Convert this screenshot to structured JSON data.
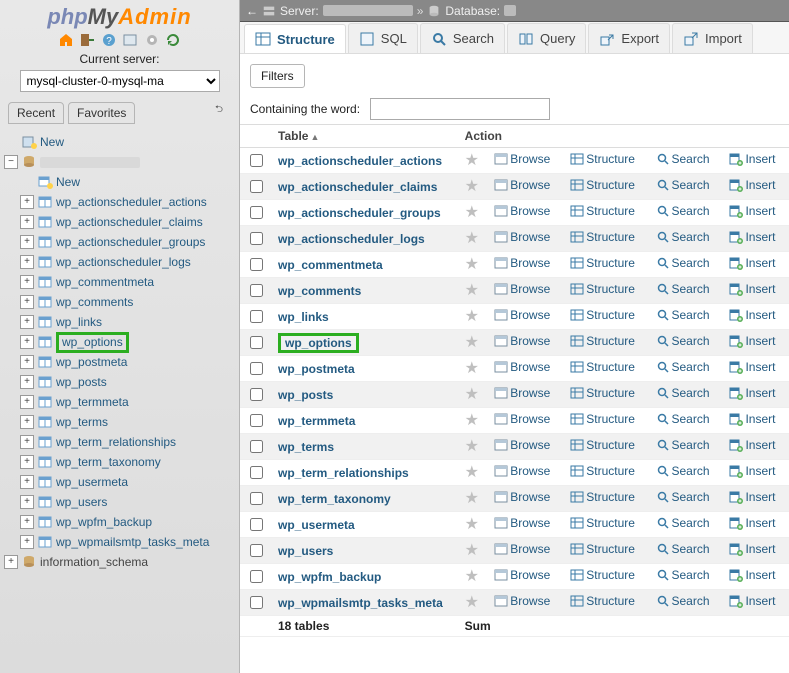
{
  "sidebar": {
    "logo": {
      "php": "php",
      "my": "My",
      "admin": "Admin"
    },
    "current_server_label": "Current server:",
    "server_select_value": "mysql-cluster-0-mysql-ma",
    "tabs": {
      "recent": "Recent",
      "favorites": "Favorites"
    },
    "root_new": "New",
    "db_new": "New",
    "tables": [
      "wp_actionscheduler_actions",
      "wp_actionscheduler_claims",
      "wp_actionscheduler_groups",
      "wp_actionscheduler_logs",
      "wp_commentmeta",
      "wp_comments",
      "wp_links",
      "wp_options",
      "wp_postmeta",
      "wp_posts",
      "wp_termmeta",
      "wp_terms",
      "wp_term_relationships",
      "wp_term_taxonomy",
      "wp_usermeta",
      "wp_users",
      "wp_wpfm_backup",
      "wp_wpmailsmtp_tasks_meta"
    ],
    "info_schema": "information_schema",
    "highlight_table": "wp_options"
  },
  "breadcrumb": {
    "server_label": "Server:",
    "database_label": "Database:"
  },
  "maintabs": [
    "Structure",
    "SQL",
    "Search",
    "Query",
    "Export",
    "Import"
  ],
  "active_tab": "Structure",
  "filters": {
    "title": "Filters",
    "containing": "Containing the word:"
  },
  "columns": {
    "table": "Table",
    "action": "Action"
  },
  "row_actions": {
    "browse": "Browse",
    "structure": "Structure",
    "search": "Search",
    "insert": "Insert"
  },
  "rows": [
    "wp_actionscheduler_actions",
    "wp_actionscheduler_claims",
    "wp_actionscheduler_groups",
    "wp_actionscheduler_logs",
    "wp_commentmeta",
    "wp_comments",
    "wp_links",
    "wp_options",
    "wp_postmeta",
    "wp_posts",
    "wp_termmeta",
    "wp_terms",
    "wp_term_relationships",
    "wp_term_taxonomy",
    "wp_usermeta",
    "wp_users",
    "wp_wpfm_backup",
    "wp_wpmailsmtp_tasks_meta"
  ],
  "highlight_row": "wp_options",
  "footer": {
    "count": "18 tables",
    "sum": "Sum"
  }
}
